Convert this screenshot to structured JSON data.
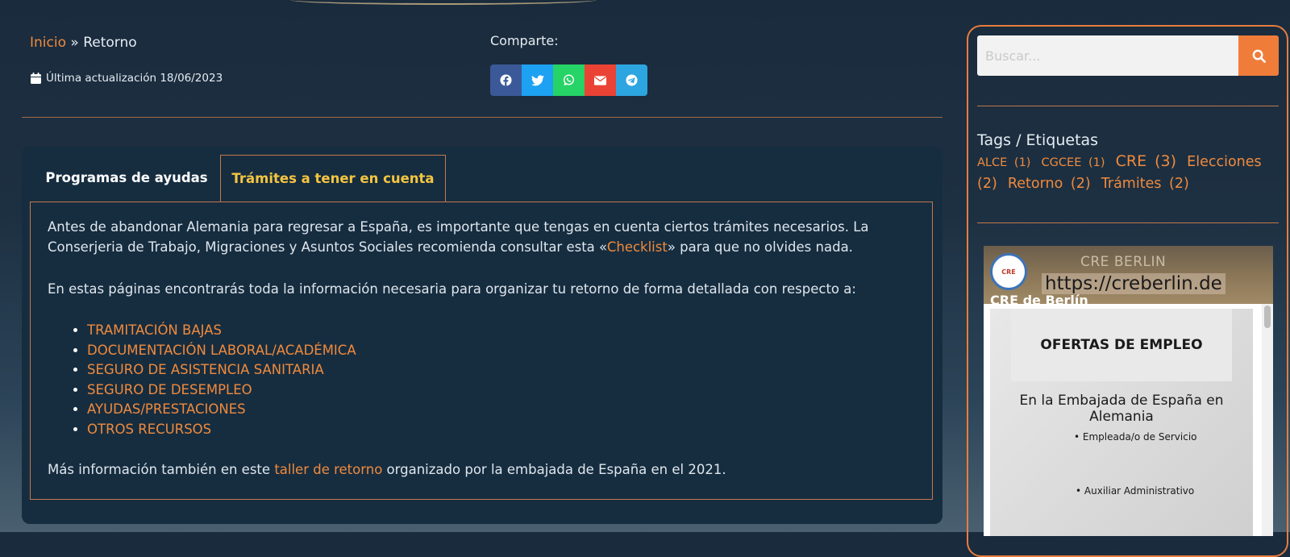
{
  "breadcrumb": {
    "home": "Inicio",
    "separator": " » ",
    "current": "Retorno"
  },
  "updated": {
    "icon": "calendar-icon",
    "text": "Última actualización 18/06/2023"
  },
  "share": {
    "label": "Comparte:",
    "buttons": [
      {
        "name": "facebook",
        "color": "#3b5998"
      },
      {
        "name": "twitter",
        "color": "#1da1f2"
      },
      {
        "name": "whatsapp",
        "color": "#25d366"
      },
      {
        "name": "email",
        "color": "#ea4335"
      },
      {
        "name": "telegram",
        "color": "#2ca5e0"
      }
    ]
  },
  "tabs": {
    "tab1": "Programas de ayudas",
    "tab2": "Trámites a tener en cuenta",
    "active": "tab2"
  },
  "content": {
    "p1_before": "Antes de abandonar Alemania para regresar a España, es importante que tengas en cuenta ciertos trámites necesarios. La Conserjeria de Trabajo, Migraciones y Asuntos Sociales  recomienda consultar esta «",
    "p1_link": "Checklist",
    "p1_after": "» para que no olvides nada.",
    "p2": "En estas páginas encontrarás toda la información necesaria para organizar tu retorno de forma detallada con respecto a:",
    "items": [
      "TRAMITACIÓN BAJAS",
      "DOCUMENTACIÓN LABORAL/ACADÉMICA",
      "SEGURO DE ASISTENCIA SANITARIA",
      "SEGURO DE DESEMPLEO",
      "AYUDAS/PRESTACIONES",
      "OTROS RECURSOS"
    ],
    "p3_before": "Más información también en este ",
    "p3_link": "taller de retorno",
    "p3_after": " organizado por la embajada de España en el 2021."
  },
  "sidebar": {
    "search_placeholder": "Buscar...",
    "tags_title": "Tags / Etiquetas",
    "tags": [
      {
        "label": "ALCE",
        "count": "(1)",
        "size": "small"
      },
      {
        "label": "CGCEE",
        "count": "(1)",
        "size": "small"
      },
      {
        "label": "CRE",
        "count": "(3)",
        "size": "large"
      },
      {
        "label": "Elecciones",
        "count": "(2)",
        "size": "medium"
      },
      {
        "label": "Retorno",
        "count": "(2)",
        "size": "medium"
      },
      {
        "label": "Trámites",
        "count": "(2)",
        "size": "medium"
      }
    ]
  },
  "widget": {
    "page_name": "CRE BERLIN",
    "url": "https://creberlin.de",
    "account": "CRE de Berlín",
    "post_title": "OFERTAS DE EMPLEO",
    "post_subtitle": "En la Embajada de España en Alemania",
    "jobs": [
      "Empleada/o de Servicio",
      "Auxiliar Administrativo"
    ]
  }
}
